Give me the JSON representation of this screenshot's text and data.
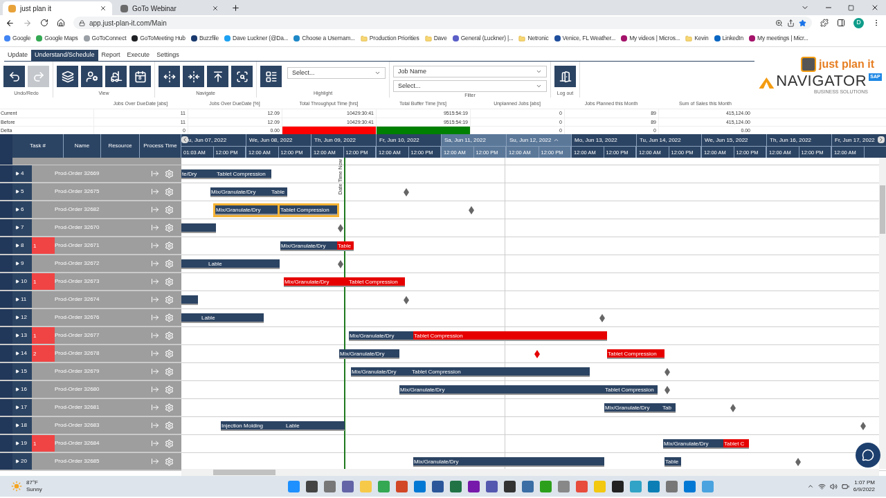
{
  "browser": {
    "tabs": [
      {
        "title": "just plan it",
        "selected": true
      },
      {
        "title": "GoTo Webinar",
        "selected": false
      }
    ],
    "url": "app.just-plan-it.com/Main",
    "profile": "D",
    "bookmarks": [
      {
        "label": "Google",
        "kind": "site",
        "color": "#4285f4"
      },
      {
        "label": "Google Maps",
        "kind": "site",
        "color": "#34a853"
      },
      {
        "label": "GoToConnect",
        "kind": "site",
        "color": "#9aa0a6"
      },
      {
        "label": "GoToMeeting Hub",
        "kind": "site",
        "color": "#202124"
      },
      {
        "label": "Buzzfile",
        "kind": "site",
        "color": "#1a3a6e"
      },
      {
        "label": "Dave Luckner (@Da...",
        "kind": "site",
        "color": "#1da1f2"
      },
      {
        "label": "Choose a Usernam...",
        "kind": "site",
        "color": "#1e88c7"
      },
      {
        "label": "Production Priorities",
        "kind": "folder"
      },
      {
        "label": "Dave",
        "kind": "folder"
      },
      {
        "label": "General (Luckner) |...",
        "kind": "site",
        "color": "#5b5fc7"
      },
      {
        "label": "Netronic",
        "kind": "folder"
      },
      {
        "label": "Venice, FL Weather...",
        "kind": "site",
        "color": "#1f4e9c"
      },
      {
        "label": "My videos | Micros...",
        "kind": "site",
        "color": "#a4136a"
      },
      {
        "label": "Kevin",
        "kind": "folder"
      },
      {
        "label": "LinkedIn",
        "kind": "site",
        "color": "#0a66c2"
      },
      {
        "label": "My meetings | Micr...",
        "kind": "site",
        "color": "#a4136a"
      }
    ]
  },
  "app": {
    "menu": [
      {
        "label": "Update",
        "selected": false
      },
      {
        "label": "Understand/Schedule",
        "selected": true
      },
      {
        "label": "Report",
        "selected": false
      },
      {
        "label": "Execute",
        "selected": false
      },
      {
        "label": "Settings",
        "selected": false
      }
    ],
    "toolbar": [
      {
        "label": "Undo/Redo",
        "tools": [
          {
            "kind": "undo",
            "disabled": false
          },
          {
            "kind": "redo",
            "disabled": true
          }
        ]
      },
      {
        "label": "View",
        "tools": [
          {
            "kind": "layers",
            "disabled": false
          },
          {
            "kind": "worker",
            "disabled": false
          },
          {
            "kind": "forklift",
            "disabled": false
          },
          {
            "kind": "calendar",
            "disabled": false,
            "text": "8"
          }
        ]
      },
      {
        "label": "Navigate",
        "tools": [
          {
            "kind": "expand",
            "disabled": false
          },
          {
            "kind": "collapse",
            "disabled": false
          },
          {
            "kind": "top",
            "disabled": false
          },
          {
            "kind": "find",
            "disabled": false
          }
        ]
      },
      {
        "label": "Highlight",
        "tools": [
          {
            "kind": "highlight",
            "disabled": false
          }
        ],
        "selects": [
          {
            "placeholder": "Select..."
          }
        ]
      },
      {
        "label": "Filter",
        "selects": [
          {
            "value": "Job Name"
          },
          {
            "placeholder": "Select..."
          }
        ]
      },
      {
        "label": "Log out",
        "tools": [
          {
            "kind": "logout",
            "disabled": false
          }
        ]
      }
    ],
    "logo": {
      "top": "just plan it",
      "main": "NAVIGATOR",
      "badge": "SAP",
      "sub": "BUSINESS SOLUTIONS"
    }
  },
  "metrics": {
    "columns": [
      "Jobs Over DueDate [abs]",
      "Jobs Over DueDate [%]",
      "Total Throughput Time [hrs]",
      "Total Buffer Time [hrs]",
      "Unplanned Jobs [abs]",
      "Jobs Planned this Month",
      "Sum of Sales this Month"
    ],
    "rows": [
      {
        "label": "Current",
        "cells": [
          {
            "value": "11"
          },
          {
            "value": "12.09"
          },
          {
            "value": "10429:30:41"
          },
          {
            "value": "9515:54:19"
          },
          {
            "value": "0"
          },
          {
            "value": "89"
          },
          {
            "value": "415,124.00"
          }
        ]
      },
      {
        "label": "Before",
        "cells": [
          {
            "value": "11"
          },
          {
            "value": "12.09"
          },
          {
            "value": "10429:30:41"
          },
          {
            "value": "9515:54:19"
          },
          {
            "value": "0"
          },
          {
            "value": "89"
          },
          {
            "value": "415,124.00"
          }
        ]
      },
      {
        "label": "Delta",
        "cells": [
          {
            "value": "0"
          },
          {
            "value": "0.00"
          },
          {
            "color": "#ff0000"
          },
          {
            "color": "#008000"
          },
          {
            "value": "0"
          },
          {
            "value": "0"
          },
          {
            "value": "0.00"
          }
        ]
      }
    ]
  },
  "gantt": {
    "columns": [
      "Task #",
      "Name",
      "Resource",
      "Process Time"
    ],
    "days": [
      {
        "label": "u, Jun 07, 2022",
        "weekend": false,
        "hours": [
          "01:03 AM",
          "12:00 PM"
        ]
      },
      {
        "label": "We, Jun 08, 2022",
        "weekend": false,
        "hours": [
          "12:00 AM",
          "12:00 PM"
        ]
      },
      {
        "label": "Th, Jun 09, 2022",
        "weekend": false,
        "hours": [
          "12:00 AM",
          "12:00 PM"
        ]
      },
      {
        "label": "Fr, Jun 10, 2022",
        "weekend": false,
        "hours": [
          "12:00 AM",
          "12:00 PM"
        ]
      },
      {
        "label": "Sa, Jun 11, 2022",
        "weekend": true,
        "hours": [
          "12:00 AM",
          "12:00 PM"
        ]
      },
      {
        "label": "Su, Jun 12, 2022",
        "weekend": true,
        "hours": [
          "12:00 AM",
          "12:00 PM"
        ]
      },
      {
        "label": "Mo, Jun 13, 2022",
        "weekend": false,
        "hours": [
          "12:00 AM",
          "12:00 PM"
        ]
      },
      {
        "label": "Tu, Jun 14, 2022",
        "weekend": false,
        "hours": [
          "12:00 AM",
          "12:00 PM"
        ]
      },
      {
        "label": "We, Jun 15, 2022",
        "weekend": false,
        "hours": [
          "12:00 AM",
          "12:00 PM"
        ]
      },
      {
        "label": "Th, Jun 16, 2022",
        "weekend": false,
        "hours": [
          "12:00 AM",
          "12:00 PM"
        ]
      },
      {
        "label": "Fr, Jun 17, 2022",
        "weekend": false,
        "hours": [
          "12:00 AM"
        ]
      }
    ],
    "now_label": "Date Time Now",
    "rows": [
      {
        "task": "4",
        "name": "Prod-Order 32669",
        "highlighted": false,
        "bars": [
          {
            "label": "te/Dry",
            "late": false
          },
          {
            "label": "Tablet Compression",
            "late": false
          }
        ],
        "milestones": []
      },
      {
        "task": "5",
        "name": "Prod-Order 32675",
        "highlighted": false,
        "bars": [
          {
            "label": "Mix/Granulate/Dry",
            "late": false
          },
          {
            "label": "Table",
            "late": false
          }
        ],
        "milestones": [
          {
            "late": false
          }
        ]
      },
      {
        "task": "6",
        "name": "Prod-Order 32682",
        "highlighted": true,
        "bars": [
          {
            "label": "Mix/Granulate/Dry",
            "late": false
          },
          {
            "label": "Tablet Compression",
            "late": false
          }
        ],
        "milestones": [
          {
            "late": false
          }
        ]
      },
      {
        "task": "7",
        "name": "Prod-Order 32670",
        "highlighted": false,
        "bars": [
          {
            "late": false
          }
        ],
        "milestones": [
          {
            "late": false
          }
        ]
      },
      {
        "task": "8",
        "flag": "1",
        "name": "Prod-Order 32671",
        "highlighted": false,
        "bars": [
          {
            "label": "Mix/Granulate/Dry",
            "late": false
          },
          {
            "label": "Table",
            "late": true
          }
        ],
        "milestones": []
      },
      {
        "task": "9",
        "name": "Prod-Order 32672",
        "highlighted": false,
        "bars": [
          {
            "late": false
          },
          {
            "label": "Lable",
            "late": false
          }
        ],
        "milestones": [
          {
            "late": false
          }
        ]
      },
      {
        "task": "10",
        "flag": "1",
        "name": "Prod-Order 32673",
        "highlighted": false,
        "bars": [
          {
            "label": "Mix/Granulate/Dry",
            "late": true
          },
          {
            "label": "Tablet Compression",
            "late": true
          }
        ],
        "milestones": []
      },
      {
        "task": "11",
        "name": "Prod-Order 32674",
        "highlighted": false,
        "bars": [
          {
            "late": false
          }
        ],
        "milestones": [
          {
            "late": false
          }
        ]
      },
      {
        "task": "12",
        "name": "Prod-Order 32676",
        "highlighted": false,
        "bars": [
          {
            "late": false
          },
          {
            "label": "Lable",
            "late": false
          }
        ],
        "milestones": [
          {
            "late": false
          }
        ]
      },
      {
        "task": "13",
        "flag": "1",
        "name": "Prod-Order 32677",
        "highlighted": false,
        "bars": [
          {
            "label": "Mix/Granulate/Dry",
            "late": false
          },
          {
            "label": "Tablet Compression",
            "late": true
          }
        ],
        "milestones": []
      },
      {
        "task": "14",
        "flag": "2",
        "name": "Prod-Order 32678",
        "highlighted": false,
        "bars": [
          {
            "label": "Mix/Granulate/Dry",
            "late": false
          },
          {
            "label": "Tablet Compression",
            "late": true
          }
        ],
        "milestones": [
          {
            "late": true
          }
        ]
      },
      {
        "task": "15",
        "name": "Prod-Order 32679",
        "highlighted": false,
        "bars": [
          {
            "label": "Mix/Granulate/Dry",
            "late": false
          },
          {
            "label": "Tablet Compression",
            "late": false
          }
        ],
        "milestones": [
          {
            "late": false
          }
        ]
      },
      {
        "task": "16",
        "name": "Prod-Order 32680",
        "highlighted": false,
        "bars": [
          {
            "label": "Mix/Granulate/Dry",
            "late": false
          },
          {
            "label": "Tablet Compression",
            "late": false
          }
        ],
        "milestones": [
          {
            "late": false
          }
        ]
      },
      {
        "task": "17",
        "name": "Prod-Order 32681",
        "highlighted": false,
        "bars": [
          {
            "label": "Mix/Granulate/Dry",
            "late": false
          },
          {
            "label": "Tab",
            "late": false
          }
        ],
        "milestones": [
          {
            "late": false
          }
        ]
      },
      {
        "task": "18",
        "name": "Prod-Order 32683",
        "highlighted": false,
        "bars": [
          {
            "label": "Injection Molding",
            "late": false
          },
          {
            "label": "Lable",
            "late": false
          }
        ],
        "milestones": [
          {
            "late": false
          }
        ]
      },
      {
        "task": "19",
        "flag": "1",
        "name": "Prod-Order 32684",
        "highlighted": false,
        "bars": [
          {
            "label": "Mix/Granulate/Dry",
            "late": false
          },
          {
            "label": "Tablet C",
            "late": true
          }
        ],
        "milestones": []
      },
      {
        "task": "20",
        "name": "Prod-Order 32685",
        "highlighted": false,
        "bars": [
          {
            "label": "Mix/Granulate/Dry",
            "late": false
          },
          {
            "label": "Table",
            "late": false
          }
        ],
        "milestones": [
          {
            "late": false
          }
        ]
      }
    ]
  },
  "taskbar": {
    "temperature": "87°F",
    "weather": "Sunny",
    "time": "1:07 PM",
    "date": "6/9/2022"
  }
}
